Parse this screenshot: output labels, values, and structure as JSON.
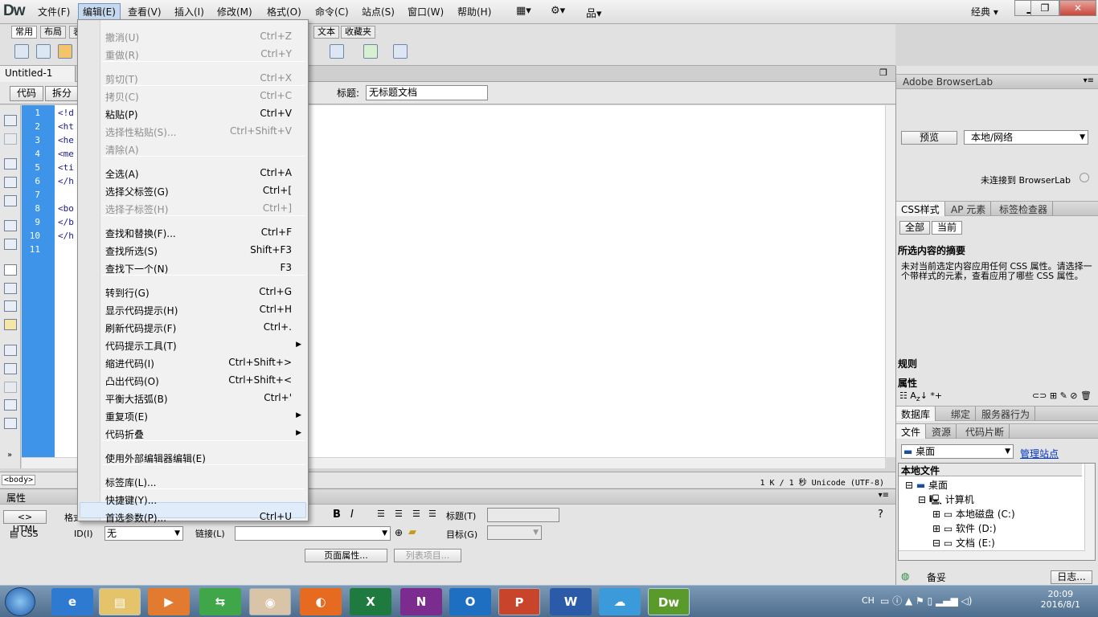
{
  "app": {
    "logo": "Dw",
    "workspace": "经典",
    "win_min": "▁",
    "win_max": "❐",
    "win_close": "✕"
  },
  "menu": [
    "文件(F)",
    "编辑(E)",
    "查看(V)",
    "插入(I)",
    "修改(M)",
    "格式(O)",
    "命令(C)",
    "站点(S)",
    "窗口(W)",
    "帮助(H)"
  ],
  "insert_tabs": [
    "常用",
    "布局",
    "表",
    "文本",
    "收藏夹"
  ],
  "document": {
    "tab": "Untitled-1",
    "view_code": "代码",
    "view_split": "拆分",
    "title_label": "标题:",
    "title_value": "无标题文档"
  },
  "code_lines": [
    "<!d",
    "<ht",
    "<he",
    "<me",
    "<ti",
    "</h",
    "",
    "<bo",
    "</b",
    "</h",
    ""
  ],
  "line_numbers": [
    "1",
    "2",
    "3",
    "4",
    "5",
    "6",
    "7",
    "8",
    "9",
    "10",
    "11"
  ],
  "status": {
    "tag": "<body>",
    "info": "1 K / 1 秒 Unicode (UTF-8)"
  },
  "properties": {
    "title": "属性",
    "html_btn": "HTML",
    "css_btn": "CSS",
    "format_label": "格式",
    "id_label": "ID(I)",
    "id_value": "无",
    "link_label": "链接(L)",
    "title_label": "标题(T)",
    "target_label": "目标(G)",
    "page_props": "页面属性...",
    "list_items": "列表项目..."
  },
  "browserlab": {
    "title": "Adobe BrowserLab",
    "preview": "预览",
    "mode": "本地/网络",
    "status": "未连接到 BrowserLab"
  },
  "css_panel": {
    "tabs": [
      "CSS样式",
      "AP 元素",
      "标签检查器"
    ],
    "all": "全部",
    "current": "当前",
    "summary_title": "所选内容的摘要",
    "summary_text": "未对当前选定内容应用任何 CSS 属性。请选择一个带样式的元素，查看应用了哪些 CSS 属性。",
    "rules": "规则",
    "props": "属性"
  },
  "db_tabs": [
    "数据库",
    "绑定",
    "服务器行为"
  ],
  "file_panel": {
    "tabs": [
      "文件",
      "资源",
      "代码片断"
    ],
    "location": "桌面",
    "manage": "管理站点",
    "header": "本地文件",
    "tree": [
      "桌面",
      "计算机",
      "本地磁盘 (C:)",
      "软件 (D:)",
      "文档 (E:)"
    ],
    "ready": "备妥",
    "log": "日志..."
  },
  "edit_menu": [
    {
      "label": "撤消(U)",
      "shortcut": "Ctrl+Z",
      "disabled": true
    },
    {
      "label": "重做(R)",
      "shortcut": "Ctrl+Y",
      "disabled": true
    },
    {
      "label": "剪切(T)",
      "shortcut": "Ctrl+X",
      "disabled": true
    },
    {
      "label": "拷贝(C)",
      "shortcut": "Ctrl+C",
      "disabled": true
    },
    {
      "label": "粘贴(P)",
      "shortcut": "Ctrl+V",
      "disabled": false
    },
    {
      "label": "选择性粘贴(S)...",
      "shortcut": "Ctrl+Shift+V",
      "disabled": true
    },
    {
      "label": "清除(A)",
      "shortcut": "",
      "disabled": true
    },
    {
      "label": "全选(A)",
      "shortcut": "Ctrl+A",
      "disabled": false
    },
    {
      "label": "选择父标签(G)",
      "shortcut": "Ctrl+[",
      "disabled": false
    },
    {
      "label": "选择子标签(H)",
      "shortcut": "Ctrl+]",
      "disabled": true
    },
    {
      "label": "查找和替换(F)...",
      "shortcut": "Ctrl+F",
      "disabled": false
    },
    {
      "label": "查找所选(S)",
      "shortcut": "Shift+F3",
      "disabled": false
    },
    {
      "label": "查找下一个(N)",
      "shortcut": "F3",
      "disabled": false
    },
    {
      "label": "转到行(G)",
      "shortcut": "Ctrl+G",
      "disabled": false
    },
    {
      "label": "显示代码提示(H)",
      "shortcut": "Ctrl+H",
      "disabled": false
    },
    {
      "label": "刷新代码提示(F)",
      "shortcut": "Ctrl+.",
      "disabled": false
    },
    {
      "label": "代码提示工具(T)",
      "shortcut": "",
      "disabled": false
    },
    {
      "label": "缩进代码(I)",
      "shortcut": "Ctrl+Shift+>",
      "disabled": false
    },
    {
      "label": "凸出代码(O)",
      "shortcut": "Ctrl+Shift+<",
      "disabled": false
    },
    {
      "label": "平衡大括弧(B)",
      "shortcut": "Ctrl+'",
      "disabled": false
    },
    {
      "label": "重复项(E)",
      "shortcut": "",
      "disabled": false
    },
    {
      "label": "代码折叠",
      "shortcut": "",
      "disabled": false
    },
    {
      "label": "使用外部编辑器编辑(E)",
      "shortcut": "",
      "disabled": false
    },
    {
      "label": "标签库(L)...",
      "shortcut": "",
      "disabled": false
    },
    {
      "label": "快捷键(Y)...",
      "shortcut": "",
      "disabled": false
    },
    {
      "label": "首选参数(P)...",
      "shortcut": "Ctrl+U",
      "disabled": false
    }
  ],
  "taskbar": {
    "time": "20:09",
    "date": "2016/8/1",
    "lang": "CH",
    "apps": [
      "ie",
      "explorer",
      "media",
      "sync",
      "chrome",
      "firefox",
      "excel",
      "onenote",
      "outlook",
      "powerpoint",
      "word",
      "baidu",
      "dreamweaver"
    ]
  }
}
